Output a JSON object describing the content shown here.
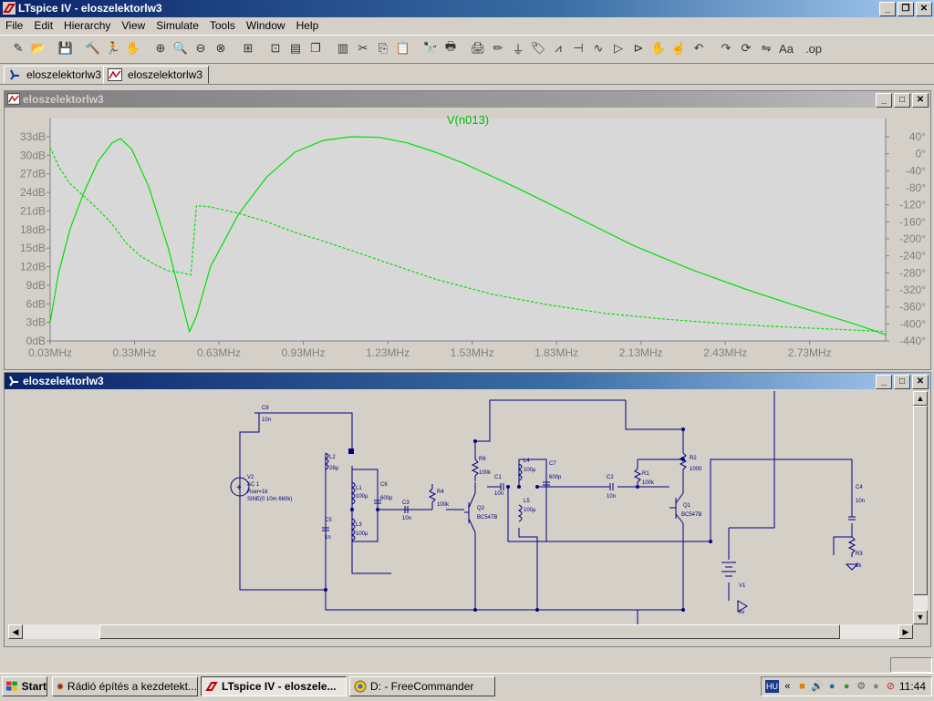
{
  "app": {
    "title": "LTspice IV - eloszelektorlw3"
  },
  "menu": [
    "File",
    "Edit",
    "Hierarchy",
    "View",
    "Simulate",
    "Tools",
    "Window",
    "Help"
  ],
  "toolbar_icons": [
    "new-schematic-icon",
    "open-icon",
    "save-icon",
    "control-panel-icon",
    "run-icon",
    "halt-icon",
    "zoom-in-icon",
    "zoom-area-icon",
    "zoom-out-icon",
    "zoom-cancel-icon",
    "autorange-icon",
    "grid-icon",
    "tile-horizontal-icon",
    "cascade-icon",
    "tile-vertical-icon",
    "cut-icon",
    "copy-icon",
    "paste-icon",
    "find-icon",
    "print-preview-icon",
    "print-icon",
    "draw-wire-icon",
    "ground-icon",
    "label-net-icon",
    "resistor-icon",
    "capacitor-icon",
    "inductor-icon",
    "diode-icon",
    "component-icon",
    "move-icon",
    "drag-icon",
    "undo-icon",
    "redo-icon",
    "rotate-icon",
    "mirror-icon",
    "text-icon",
    "spice-directive-icon"
  ],
  "tabs": [
    {
      "label": "eloszelektorlw3",
      "icon": "schematic-icon"
    },
    {
      "label": "eloszelektorlw3",
      "icon": "waveform-icon"
    }
  ],
  "waveform_window": {
    "title": "eloszelektorlw3"
  },
  "schematic_window": {
    "title": "eloszelektorlw3"
  },
  "chart_data": {
    "type": "line",
    "title": "V(n013)",
    "xlabel": "",
    "ylabel": "",
    "x_ticks": [
      "0.03MHz",
      "0.33MHz",
      "0.63MHz",
      "0.93MHz",
      "1.23MHz",
      "1.53MHz",
      "1.83MHz",
      "2.13MHz",
      "2.43MHz",
      "2.73MHz"
    ],
    "y_ticks_left": [
      "0dB",
      "3dB",
      "6dB",
      "9dB",
      "12dB",
      "15dB",
      "18dB",
      "21dB",
      "24dB",
      "27dB",
      "30dB",
      "33dB"
    ],
    "y_ticks_right": [
      "40°",
      "0°",
      "-40°",
      "-80°",
      "-120°",
      "-160°",
      "-200°",
      "-240°",
      "-280°",
      "-320°",
      "-360°",
      "-400°",
      "-440°"
    ],
    "xlim": [
      0.03,
      3.0
    ],
    "ylim_left": [
      0,
      33
    ],
    "ylim_right": [
      -440,
      40
    ],
    "color": "#00e000",
    "series": [
      {
        "style": "solid",
        "axis": "left",
        "x": [
          0.03,
          0.06,
          0.1,
          0.15,
          0.2,
          0.25,
          0.28,
          0.32,
          0.38,
          0.45,
          0.5,
          0.525,
          0.55,
          0.6,
          0.7,
          0.8,
          0.9,
          1.0,
          1.1,
          1.2,
          1.3,
          1.4,
          1.5,
          1.7,
          1.9,
          2.1,
          2.3,
          2.5,
          2.7,
          2.9,
          3.0
        ],
        "y": [
          3,
          11,
          18,
          24,
          29,
          32,
          32.7,
          31,
          25,
          15,
          6,
          1.5,
          4,
          12,
          20.5,
          26.5,
          30.5,
          32.4,
          33.0,
          32.9,
          32,
          30.5,
          28.7,
          24.5,
          20,
          15.5,
          11.7,
          8.4,
          5.4,
          2.6,
          1.0
        ]
      },
      {
        "style": "dashed",
        "axis": "right",
        "x": [
          0.03,
          0.06,
          0.1,
          0.15,
          0.2,
          0.25,
          0.3,
          0.35,
          0.4,
          0.45,
          0.5,
          0.53,
          0.55,
          0.6,
          0.7,
          0.8,
          0.9,
          1.0,
          1.2,
          1.4,
          1.6,
          1.8,
          2.0,
          2.2,
          2.4,
          2.6,
          2.8,
          3.0
        ],
        "y": [
          15,
          -30,
          -70,
          -100,
          -130,
          -165,
          -210,
          -240,
          -260,
          -275,
          -280,
          -285,
          -122,
          -125,
          -140,
          -160,
          -185,
          -205,
          -250,
          -295,
          -330,
          -355,
          -375,
          -388,
          -398,
          -406,
          -412,
          -418
        ]
      }
    ],
    "grid": false,
    "background": "#d8d8d8"
  },
  "schematic_labels": {
    "c8": "C8",
    "c8_val": "10n",
    "l2": "L2",
    "l2_val": "28µ",
    "v2": "V2",
    "v2_l1": "AC 1",
    "v2_l2": "Rser=1k",
    "v2_l3": "SINE(0 10m 660k)",
    "c5": "C5",
    "c5_val": "1n",
    "l1": "L1",
    "l1_val": "100µ",
    "l3": "L3",
    "l3_val": "100µ",
    "c6": "C6",
    "c6_val": "600p",
    "c3": "C3",
    "c3_val": "10n",
    "r4": "R4",
    "r4_val": "100k",
    "r6": "R6",
    "r6_val": "100k",
    "c1": "C1",
    "c1_val": "10n",
    "q2": "Q2",
    "q2_model": "BC547B",
    "l4": "L4",
    "l4_val": "100µ",
    "l5": "L5",
    "l5_val": "100µ",
    "c7": "C7",
    "c7_val": "600p",
    "c2": "C2",
    "c2_val": "10n",
    "r1": "R1",
    "r1_val": "100k",
    "r2": "R2",
    "r2_val": "1000",
    "q1": "Q1",
    "q1_model": "BC547B",
    "c4": "C4",
    "c4_val": "10n",
    "r3": "R3",
    "r3_val": "2k",
    "v1": "V1",
    "v1_val": "6v"
  },
  "taskbar": {
    "start": "Start",
    "tasks": [
      {
        "label": "Rádió építés a kezdetekt...",
        "icon": "firefox-icon"
      },
      {
        "label": "LTspice IV - eloszele...",
        "icon": "ltspice-icon",
        "active": true
      },
      {
        "label": "D: - FreeCommander",
        "icon": "freecommander-icon"
      }
    ],
    "tray_lang": "HU",
    "clock": "11:44"
  }
}
